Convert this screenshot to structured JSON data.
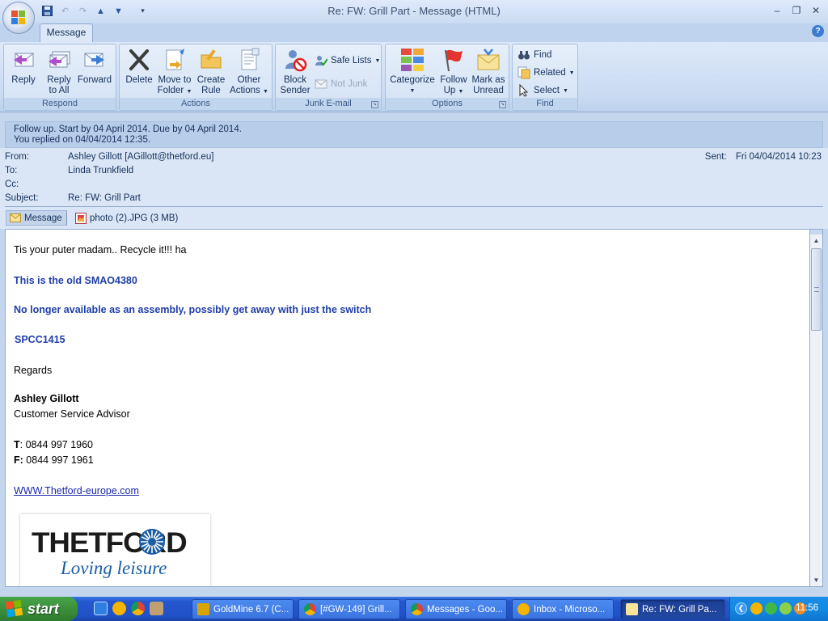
{
  "window": {
    "title": "Re: FW: Grill Part - Message (HTML)"
  },
  "ribbon": {
    "tab": "Message",
    "groups": {
      "respond": {
        "label": "Respond",
        "reply": "Reply",
        "reply_all_1": "Reply",
        "reply_all_2": "to All",
        "forward": "Forward"
      },
      "actions": {
        "label": "Actions",
        "delete": "Delete",
        "move_1": "Move to",
        "move_2": "Folder",
        "create_1": "Create",
        "create_2": "Rule",
        "other_1": "Other",
        "other_2": "Actions"
      },
      "junk": {
        "label": "Junk E-mail",
        "block_1": "Block",
        "block_2": "Sender",
        "safe_lists": "Safe Lists",
        "not_junk": "Not Junk"
      },
      "options": {
        "label": "Options",
        "categorize": "Categorize",
        "follow_1": "Follow",
        "follow_2": "Up",
        "mark_1": "Mark as",
        "mark_2": "Unread"
      },
      "find": {
        "label": "Find",
        "find": "Find",
        "related": "Related",
        "select": "Select"
      }
    }
  },
  "infobar": {
    "line1": "Follow up.  Start by 04 April 2014.  Due by 04 April 2014.",
    "line2": "You replied on 04/04/2014 12:35."
  },
  "header": {
    "from_label": "From:",
    "from": "Ashley Gillott [AGillott@thetford.eu]",
    "to_label": "To:",
    "to": "Linda Trunkfield",
    "cc_label": "Cc:",
    "cc": "",
    "subject_label": "Subject:",
    "subject": "Re: FW: Grill Part",
    "sent_label": "Sent:",
    "sent": "Fri 04/04/2014 10:23"
  },
  "attachments": {
    "message": "Message",
    "photo": "photo (2).JPG (3 MB)"
  },
  "body": {
    "line1": "Tis your puter madam..  Recycle it!!! ha",
    "line2": "This is the old SMAO4380",
    "line3": "No longer available as an assembly, possibly get away with just the switch",
    "line4": "SPCC1415",
    "regards": "Regards",
    "sig_name": "Ashley Gillott",
    "sig_title": "Customer Service Advisor",
    "tel_label": "T",
    "tel": ": 0844 997 1960",
    "fax_label": "F:",
    "fax": " 0844 997 1961",
    "website": "WWW.Thetford-europe.com",
    "logo_word": "THETFORD",
    "logo_tagline": "Loving leisure"
  },
  "taskbar": {
    "start": "start",
    "tasks": [
      {
        "label": "GoldMine 6.7 (C..."
      },
      {
        "label": "[#GW-149] Grill..."
      },
      {
        "label": "Messages - Goo..."
      },
      {
        "label": "Inbox - Microso..."
      },
      {
        "label": "Re: FW: Grill Pa..."
      }
    ],
    "clock": "11:56"
  },
  "colors": {
    "ribbon_bg": "#dde9f8",
    "signature_blue": "#1f3ea8",
    "taskbar_blue": "#2457cf",
    "start_green": "#3c8f3c"
  }
}
